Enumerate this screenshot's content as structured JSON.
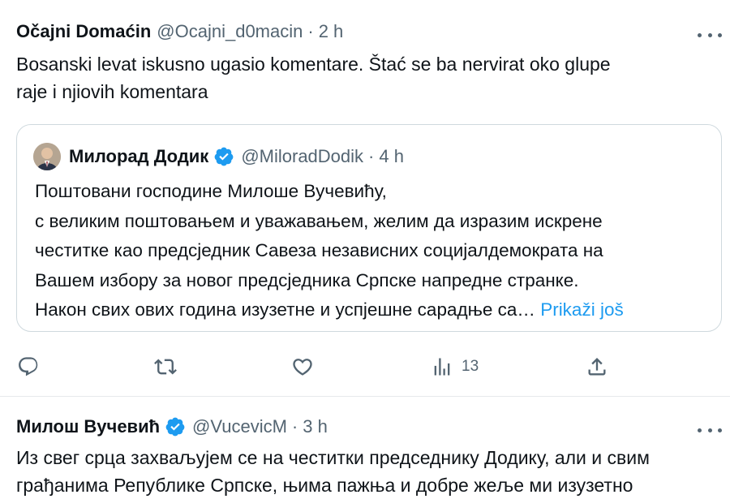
{
  "tweets": [
    {
      "display_name": "Očajni Domaćin",
      "handle": "@Ocajni_d0macin",
      "separator": "·",
      "time": "2 h",
      "text_line1": "Bosanski levat iskusno ugasio komentare. Štać se ba nervirat oko glupe",
      "text_line2": "raje i njiovih komentara",
      "quoted": {
        "display_name": "Милорад Додик",
        "handle": "@MiloradDodik",
        "separator": "·",
        "time": "4 h",
        "lines": [
          "Поштовани господине Милоше Вучевићу,",
          "с великим поштовањем и уважавањем, желим да изразим искрене",
          "честитке као предсједник Савеза независних социјалдемократа на",
          "Вашем избору за новог предсједника Српске напредне странке.",
          "Након свих ових година изузетне и успјешне сарадње са…"
        ],
        "show_more": "Prikaži još"
      },
      "actions": {
        "views_count": "13"
      }
    },
    {
      "display_name": "Милош Вучевић",
      "handle": "@VucevicM",
      "separator": "·",
      "time": "3 h",
      "text_line1": "Из свег срца захваљујем се на честитки председнику Додику, али и свим",
      "text_line2": "грађанима Републике Српске, њима пажња и добре жеље ми изузетно"
    }
  ],
  "colors": {
    "accent": "#1d9bf0",
    "secondary_text": "#536471",
    "border": "#cfd9de"
  },
  "icons": [
    "more-icon",
    "verified-badge-icon",
    "reply-icon",
    "retweet-icon",
    "like-icon",
    "views-icon",
    "share-icon"
  ]
}
